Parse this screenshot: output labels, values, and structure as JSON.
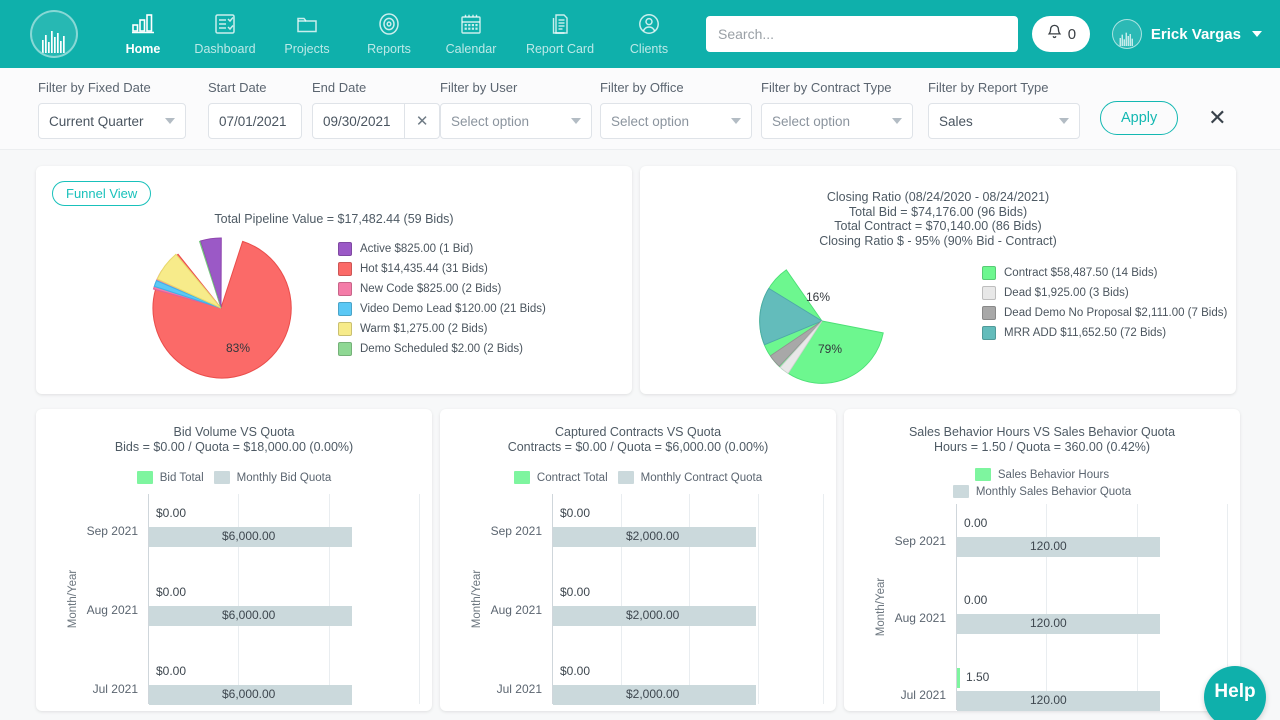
{
  "header": {
    "logo_icon": "bar-waveform-logo-icon",
    "nav": [
      {
        "label": "Home",
        "icon": "bar-chart-icon",
        "active": true
      },
      {
        "label": "Dashboard",
        "icon": "checklist-icon",
        "active": false
      },
      {
        "label": "Projects",
        "icon": "folder-icon",
        "active": false
      },
      {
        "label": "Reports",
        "icon": "target-icon",
        "active": false
      },
      {
        "label": "Calendar",
        "icon": "calendar-icon",
        "active": false
      },
      {
        "label": "Report Card",
        "icon": "documents-icon",
        "active": false
      },
      {
        "label": "Clients",
        "icon": "user-circle-icon",
        "active": false
      }
    ],
    "search_placeholder": "Search...",
    "search_value": "",
    "notification_count": "0",
    "user_name": "Erick Vargas",
    "brand_color": "#0fb0ab"
  },
  "filters": {
    "fixed_date": {
      "label": "Filter by Fixed Date",
      "value": "Current Quarter"
    },
    "start_date": {
      "label": "Start Date",
      "value": "07/01/2021"
    },
    "end_date": {
      "label": "End Date",
      "value": "09/30/2021",
      "clear_icon": "x-icon"
    },
    "user": {
      "label": "Filter by User",
      "value": "Select option"
    },
    "office": {
      "label": "Filter by Office",
      "value": "Select option"
    },
    "contract_type": {
      "label": "Filter by Contract Type",
      "value": "Select option"
    },
    "report_type": {
      "label": "Filter by Report Type",
      "value": "Sales"
    },
    "apply_label": "Apply",
    "close_icon": "x-icon"
  },
  "chart_data": [
    {
      "type": "pie",
      "id": "pipeline",
      "badge": "Funnel View",
      "title": "Total Pipeline Value = $17,482.44 (59 Bids)",
      "slice_labels": [
        {
          "text": "83%"
        }
      ],
      "legend_position": "right",
      "categories": [
        "Active",
        "Hot",
        "New Code",
        "Video Demo Lead",
        "Warm",
        "Demo Scheduled"
      ],
      "values": [
        825.0,
        14435.44,
        825.0,
        120.0,
        1275.0,
        2.0
      ],
      "counts": [
        1,
        31,
        2,
        21,
        2,
        2
      ],
      "colors": [
        "#9b59c6",
        "#fb6a68",
        "#f47ca8",
        "#5bc8f5",
        "#f7eb8a",
        "#8fd894"
      ],
      "legend": [
        "Active $825.00 (1 Bid)",
        "Hot $14,435.44 (31 Bids)",
        "New Code $825.00 (2 Bids)",
        "Video Demo Lead $120.00 (21 Bids)",
        "Warm $1,275.00 (2 Bids)",
        "Demo Scheduled $2.00 (2 Bids)"
      ]
    },
    {
      "type": "pie",
      "id": "closing",
      "title_lines": [
        "Closing Ratio (08/24/2020 - 08/24/2021)",
        "Total Bid = $74,176.00 (96 Bids)",
        "Total Contract = $70,140.00 (86 Bids)",
        "Closing Ratio $ - 95% (90% Bid - Contract)"
      ],
      "slice_labels": [
        {
          "text": "16%"
        },
        {
          "text": "79%"
        }
      ],
      "legend_position": "right",
      "categories": [
        "Contract",
        "Dead",
        "Dead Demo No Proposal",
        "MRR ADD"
      ],
      "values": [
        58487.5,
        1925.0,
        2111.0,
        11652.5
      ],
      "counts": [
        14,
        3,
        7,
        72
      ],
      "colors": [
        "#6df78f",
        "#e8e8e8",
        "#a8a8a8",
        "#63bcbb"
      ],
      "legend": [
        "Contract $58,487.50 (14 Bids)",
        "Dead $1,925.00 (3 Bids)",
        "Dead Demo No Proposal $2,111.00 (7 Bids)",
        "MRR ADD $11,652.50 (72 Bids)"
      ]
    },
    {
      "type": "bar",
      "id": "bid_volume",
      "orientation": "horizontal",
      "title_lines": [
        "Bid Volume VS Quota",
        "Bids = $0.00 / Quota = $18,000.00 (0.00%)"
      ],
      "ylabel": "Month/Year",
      "legend": [
        "Bid Total",
        "Monthly Bid Quota"
      ],
      "legend_colors": [
        "#7ef59f",
        "#cbd9dc"
      ],
      "legend_layout": "inline",
      "categories": [
        "Sep 2021",
        "Aug 2021",
        "Jul 2021"
      ],
      "series": [
        {
          "name": "Bid Total",
          "values": [
            0,
            0,
            0
          ],
          "labels": [
            "$0.00",
            "$0.00",
            "$0.00"
          ]
        },
        {
          "name": "Monthly Bid Quota",
          "values": [
            6000,
            6000,
            6000
          ],
          "labels": [
            "$6,000.00",
            "$6,000.00",
            "$6,000.00"
          ]
        }
      ],
      "xmax": 8000,
      "gridlines": 3
    },
    {
      "type": "bar",
      "id": "captured_contracts",
      "orientation": "horizontal",
      "title_lines": [
        "Captured Contracts VS Quota",
        "Contracts = $0.00 / Quota = $6,000.00 (0.00%)"
      ],
      "ylabel": "Month/Year",
      "legend": [
        "Contract Total",
        "Monthly Contract Quota"
      ],
      "legend_colors": [
        "#7ef59f",
        "#cbd9dc"
      ],
      "legend_layout": "inline",
      "categories": [
        "Sep 2021",
        "Aug 2021",
        "Jul 2021"
      ],
      "series": [
        {
          "name": "Contract Total",
          "values": [
            0,
            0,
            0
          ],
          "labels": [
            "$0.00",
            "$0.00",
            "$0.00"
          ]
        },
        {
          "name": "Monthly Contract Quota",
          "values": [
            2000,
            2000,
            2000
          ],
          "labels": [
            "$2,000.00",
            "$2,000.00",
            "$2,000.00"
          ]
        }
      ],
      "xmax": 2700,
      "gridlines": 4
    },
    {
      "type": "bar",
      "id": "sales_behavior",
      "orientation": "horizontal",
      "title_lines": [
        "Sales Behavior Hours VS Sales Behavior Quota",
        "Hours = 1.50 / Quota = 360.00 (0.42%)"
      ],
      "ylabel": "Month/Year",
      "legend": [
        "Sales Behavior Hours",
        "Monthly Sales Behavior Quota"
      ],
      "legend_colors": [
        "#7ef59f",
        "#cbd9dc"
      ],
      "legend_layout": "stacked",
      "categories": [
        "Sep 2021",
        "Aug 2021",
        "Jul 2021"
      ],
      "series": [
        {
          "name": "Sales Behavior Hours",
          "values": [
            0,
            0,
            1.5
          ],
          "labels": [
            "0.00",
            "0.00",
            "1.50"
          ]
        },
        {
          "name": "Monthly Sales Behavior Quota",
          "values": [
            120,
            120,
            120
          ],
          "labels": [
            "120.00",
            "120.00",
            "120.00"
          ]
        }
      ],
      "xmax": 160,
      "gridlines": 3
    }
  ],
  "help": {
    "label": "Help"
  }
}
